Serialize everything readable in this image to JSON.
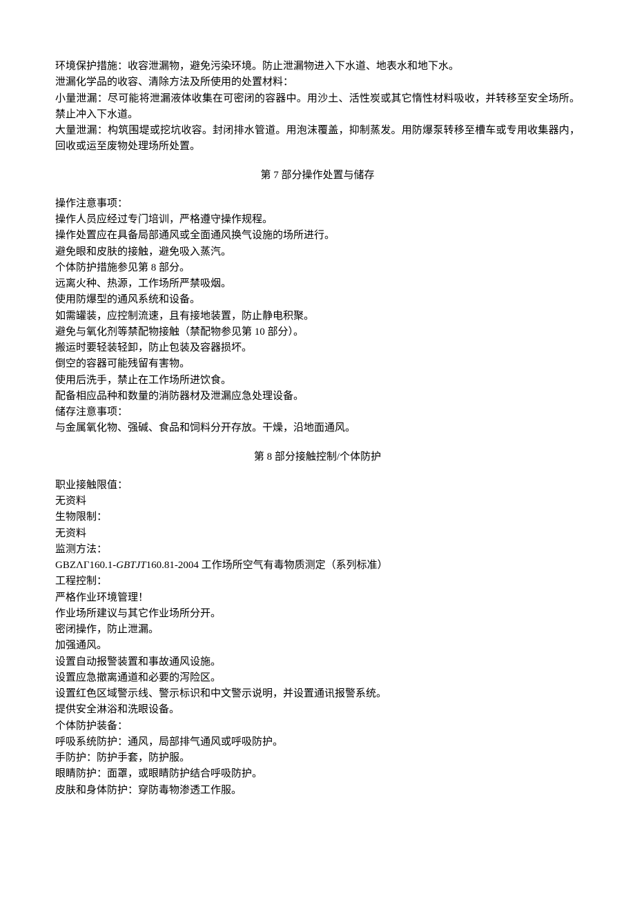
{
  "intro": {
    "p1": "环境保护措施：收容泄漏物，避免污染环境。防止泄漏物进入下水道、地表水和地下水。",
    "p2": "泄漏化学品的收容、清除方法及所使用的处置材料：",
    "p3": "小量泄漏：尽可能将泄漏液体收集在可密闭的容器中。用沙土、活性炭或其它惰性材料吸收，并转移至安全场所。禁止冲入下水道。",
    "p4": "大量泄漏：构筑围堤或挖坑收容。封闭排水管道。用泡沫覆盖，抑制蒸发。用防爆泵转移至槽车或专用收集器内，回收或运至废物处理场所处置。"
  },
  "section7": {
    "title_prefix": "第 ",
    "title_num": "7",
    "title_suffix": " 部分操作处置与储存",
    "lines": [
      "操作注意事项：",
      "操作人员应经过专门培训，严格遵守操作规程。",
      "操作处置应在具备局部通风或全面通风换气设施的场所进行。",
      "避免眼和皮肤的接触，避免吸入蒸汽。",
      "个体防护措施参见第 8 部分。",
      "远离火种、热源，工作场所严禁吸烟。",
      "使用防爆型的通风系统和设备。",
      "如需罐装，应控制流速，且有接地装置，防止静电积聚。",
      "避免与氧化剂等禁配物接触（禁配物参见第 10 部分）。",
      "搬运时要轻装轻卸，防止包装及容器损坏。",
      "倒空的容器可能残留有害物。",
      "使用后洗手，禁止在工作场所进饮食。",
      "配备相应品种和数量的消防器材及泄漏应急处理设备。",
      "储存注意事项：",
      "与金属氧化物、强碱、食品和饲料分开存放。干燥，沿地面通风。"
    ]
  },
  "section8": {
    "title_prefix": "第 ",
    "title_num": "8",
    "title_suffix": " 部分接触控制/个体防护",
    "lines_a": [
      "职业接触限值：",
      "无资料",
      "生物限制：",
      "无资料",
      "监测方法："
    ],
    "gbz_prefix": "GBZΛΓ160.1-",
    "gbz_italic": "GBTJT",
    "gbz_suffix": "160.81-2004 工作场所空气有毒物质测定（系列标准）",
    "lines_b": [
      "工程控制：",
      "严格作业环境管理！",
      "作业场所建议与其它作业场所分开。",
      "密闭操作，防止泄漏。",
      "加强通风。",
      "设置自动报警装置和事故通风设施。",
      "设置应急撤离通道和必要的泻险区。",
      "设置红色区域警示线、警示标识和中文警示说明，并设置通讯报警系统。",
      "提供安全淋浴和洗眼设备。",
      "个体防护装备：",
      "呼吸系统防护：通风，局部排气通风或呼吸防护。",
      "手防护：防护手套，防护服。",
      "眼睛防护：面罩，或眼睛防护结合呼吸防护。",
      "皮肤和身体防护：穿防毒物渗透工作服。"
    ]
  }
}
